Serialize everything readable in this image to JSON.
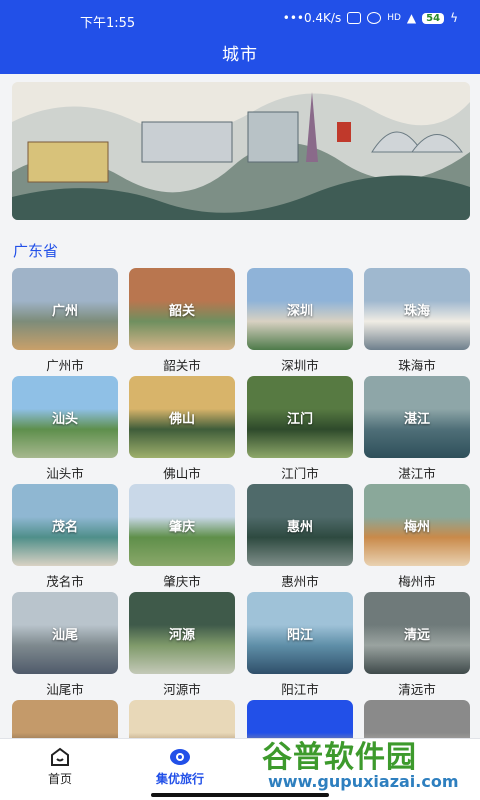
{
  "status_bar": {
    "time": "下午1:55",
    "network_speed": "•••0.4K/s",
    "signal": "HD",
    "battery": "54"
  },
  "header": {
    "title": "城市"
  },
  "province": {
    "name": "广东省"
  },
  "cities": [
    {
      "name": "广州市",
      "label": "广州"
    },
    {
      "name": "韶关市",
      "label": "韶关"
    },
    {
      "name": "深圳市",
      "label": "深圳"
    },
    {
      "name": "珠海市",
      "label": "珠海"
    },
    {
      "name": "汕头市",
      "label": "汕头"
    },
    {
      "name": "佛山市",
      "label": "佛山"
    },
    {
      "name": "江门市",
      "label": "江门"
    },
    {
      "name": "湛江市",
      "label": "湛江"
    },
    {
      "name": "茂名市",
      "label": "茂名"
    },
    {
      "name": "肇庆市",
      "label": "肇庆"
    },
    {
      "name": "惠州市",
      "label": "惠州"
    },
    {
      "name": "梅州市",
      "label": "梅州"
    },
    {
      "name": "汕尾市",
      "label": "汕尾"
    },
    {
      "name": "河源市",
      "label": "河源"
    },
    {
      "name": "阳江市",
      "label": "阳江"
    },
    {
      "name": "清远市",
      "label": "清远"
    }
  ],
  "colors": {
    "accent": "#2250e8",
    "thumbs": [
      [
        "#9fb3c8",
        "#7d8c7a",
        "#c9a06a"
      ],
      [
        "#b9764f",
        "#6f8f5f",
        "#d7b58a"
      ],
      [
        "#8fb3d8",
        "#d8d1c2",
        "#4e7a4a"
      ],
      [
        "#9fb8cf",
        "#f0ece4",
        "#6e7f8c"
      ],
      [
        "#8fc0e6",
        "#5e8f4c",
        "#a7b88f"
      ],
      [
        "#d8b46a",
        "#3f5d3a",
        "#9fb06c"
      ],
      [
        "#577a42",
        "#2e4a2b",
        "#8ea86a"
      ],
      [
        "#8ea6a8",
        "#4f6f78",
        "#2e4f5a"
      ],
      [
        "#8fb7d2",
        "#4f8f8a",
        "#d9d2c4"
      ],
      [
        "#c9d8e8",
        "#5f8f4a",
        "#8aa86a"
      ],
      [
        "#4f6a6a",
        "#2e4a40",
        "#7f8f8a"
      ],
      [
        "#8aa89a",
        "#c98a4a",
        "#e9d2b2"
      ],
      [
        "#b9c4cc",
        "#7f8a8f",
        "#4f5a6a"
      ],
      [
        "#3f5a4a",
        "#7f9a6a",
        "#c4c9b8"
      ],
      [
        "#9fc2d8",
        "#5f8fa8",
        "#2f4f6a"
      ],
      [
        "#6f7a7a",
        "#9aa3a0",
        "#3f4a4a"
      ],
      [
        "#c49a6a",
        "#5a4a3a",
        "#d8c4a8"
      ],
      [
        "#e8d8b8",
        "#8a6a4a",
        "#4a3a2a"
      ],
      [
        "#2250e8",
        "#d8b86a",
        "#4a6a9a"
      ],
      [
        "#8a8a8a",
        "#c9c4bc",
        "#5a5450"
      ]
    ]
  },
  "tabs": [
    {
      "label": "首页",
      "icon": "home-icon",
      "active": false
    },
    {
      "label": "集优旅行",
      "icon": "eye-icon",
      "active": true
    },
    {
      "label": "",
      "icon": "",
      "active": false
    },
    {
      "label": "",
      "icon": "",
      "active": false
    }
  ],
  "watermark": {
    "brand": "谷普软件园",
    "url": "www.gupuxiazai.com"
  }
}
